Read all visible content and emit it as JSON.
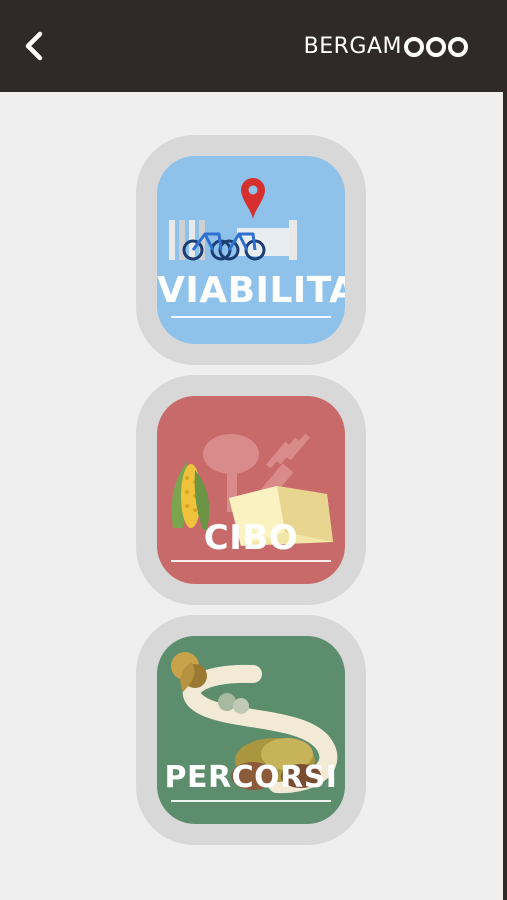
{
  "header": {
    "back_icon": "chevron-left-icon",
    "brand": "BERGAM",
    "brand_logo": "ooo-logo-icon",
    "background": "#2f2a29"
  },
  "tiles": [
    {
      "label": "VIABILITA'",
      "color": "#8ec2ea",
      "icon": "bike-map-pin-icon"
    },
    {
      "label": "CIBO",
      "color": "#c86a6a",
      "icon": "food-fork-corn-cheese-icon"
    },
    {
      "label": "PERCORSI",
      "color": "#5c8d6c",
      "icon": "path-trees-icon"
    }
  ]
}
